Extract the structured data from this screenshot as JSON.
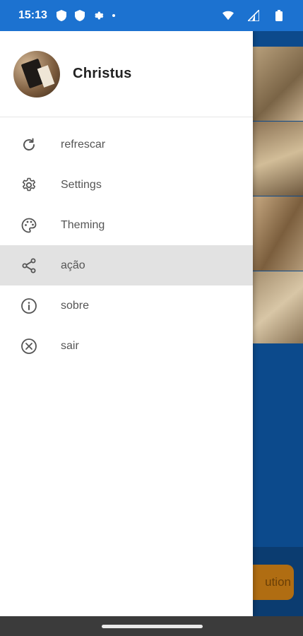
{
  "status_bar": {
    "time": "15:13",
    "icons": [
      "shield-icon",
      "shield-icon",
      "gear-icon",
      "dot-icon",
      "wifi-icon",
      "signal-icon",
      "battery-icon"
    ]
  },
  "drawer": {
    "title": "Christus",
    "items": [
      {
        "label": "refrescar",
        "icon": "refresh-icon"
      },
      {
        "label": "Settings",
        "icon": "gear-icon"
      },
      {
        "label": "Theming",
        "icon": "palette-icon"
      },
      {
        "label": "ação",
        "icon": "share-icon",
        "active": true
      },
      {
        "label": "sobre",
        "icon": "info-icon"
      },
      {
        "label": "sair",
        "icon": "close-circle-icon"
      }
    ]
  },
  "background": {
    "button_label": "ution"
  },
  "colors": {
    "status_bar": "#1c72d0",
    "active_item": "#e2e2e2",
    "background_app": "#0c4a8c",
    "accent_button": "#b06d12"
  }
}
